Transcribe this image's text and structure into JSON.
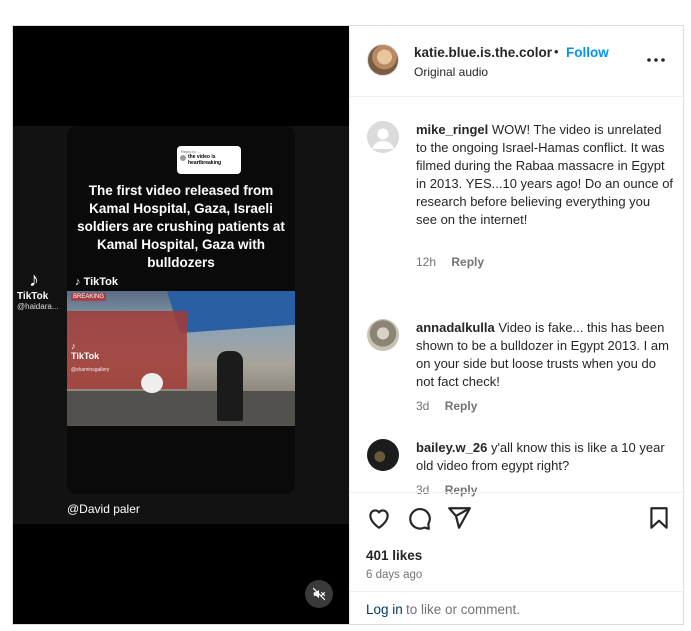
{
  "post": {
    "media": {
      "sticker": {
        "line1": "Reply to ...",
        "line2": "the video is heartbreaking"
      },
      "headline": "The first video released from Kamal Hospital, Gaza, Israeli soldiers are crushing patients at Kamal Hospital, Gaza with bulldozers",
      "tiktok_word": "TikTok",
      "tiktok_user": "@haidara...",
      "tiktok_inline": "TikTok",
      "frame_tiktok": "TikTok",
      "frame_user": "@shaminsgallery",
      "frame_top": "BREAKING",
      "credit": "@David paler"
    },
    "header": {
      "username": "katie.blue.is.the.color",
      "dot": "•",
      "follow_label": "Follow",
      "audio": "Original audio"
    },
    "comments": [
      {
        "username": "mike_ringel",
        "text": "WOW! The video is unrelated to the ongoing Israel-Hamas conflict. It was filmed during the Rabaa massacre in Egypt in 2013. YES...10 years ago! Do an ounce of research before believing everything you see on the internet!",
        "time": "12h",
        "reply_label": "Reply"
      },
      {
        "username": "annadalkulla",
        "text": "Video is fake... this has been shown to be a bulldozer in Egypt 2013. I am on your side but loose trusts when you do not fact check!",
        "time": "3d",
        "reply_label": "Reply"
      },
      {
        "username": "bailey.w_26",
        "text": "y'all know this is like a 10 year old video from egypt right?",
        "time": "3d",
        "reply_label": "Reply"
      }
    ],
    "actions": {
      "likes": "401 likes",
      "ago": "6 days ago",
      "login_link": "Log in",
      "login_rest": "to like or comment."
    },
    "icons": {
      "like": "heart-icon",
      "comment": "comment-icon",
      "share": "share-icon",
      "save": "bookmark-icon",
      "more": "more-icon",
      "mute": "muted-speaker-icon"
    },
    "colors": {
      "accent": "#0095f6",
      "link": "#00376b",
      "muted_text": "#737373"
    }
  }
}
